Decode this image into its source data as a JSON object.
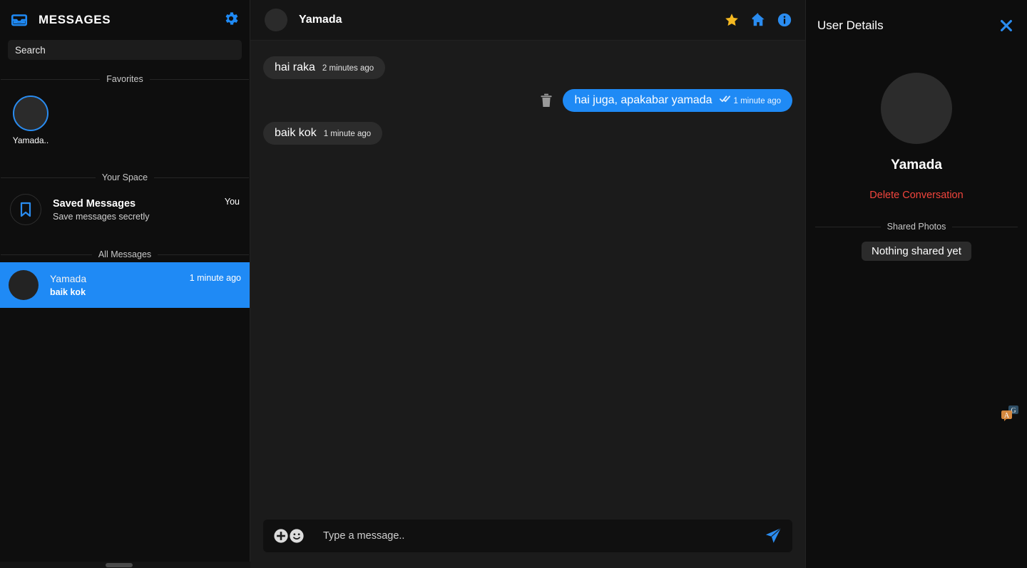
{
  "sidebar": {
    "title": "MESSAGES",
    "inbox_icon": "inbox-icon",
    "settings_icon": "gear-icon",
    "search": {
      "placeholder": "Search",
      "value": ""
    },
    "sections": {
      "favorites_label": "Favorites",
      "your_space_label": "Your Space",
      "all_messages_label": "All Messages"
    },
    "favorites": [
      {
        "name": "Yamada..",
        "avatar_icon": "avatar"
      }
    ],
    "saved_messages": {
      "icon": "bookmark-icon",
      "title": "Saved Messages",
      "subtitle": "Save messages secretly",
      "badge": "You"
    },
    "conversations": [
      {
        "name": "Yamada",
        "preview": "baik kok",
        "time": "1 minute ago",
        "active": true
      }
    ]
  },
  "chat": {
    "contact_name": "Yamada",
    "actions": [
      {
        "name": "favorite-star-icon",
        "color": "#f5b921"
      },
      {
        "name": "home-icon",
        "color": "#2a8cf0"
      },
      {
        "name": "info-icon",
        "color": "#2a8cf0"
      }
    ],
    "messages": [
      {
        "id": "m1",
        "direction": "in",
        "text": "hai raka",
        "time": "2 minutes ago",
        "read_receipt": false,
        "deletable": false
      },
      {
        "id": "m2",
        "direction": "out",
        "text": "hai juga, apakabar yamada",
        "time": "1 minute ago",
        "read_receipt": true,
        "deletable": true,
        "delete_icon": "trash-icon"
      },
      {
        "id": "m3",
        "direction": "in",
        "text": "baik kok",
        "time": "1 minute ago",
        "read_receipt": false,
        "deletable": false
      }
    ],
    "composer": {
      "attach_icon": "plus-circle-icon",
      "emoji_icon": "smiley-icon",
      "placeholder": "Type a message..",
      "value": "",
      "send_icon": "send-icon"
    }
  },
  "details": {
    "title": "User Details",
    "close_icon": "close-icon",
    "user_name": "Yamada",
    "delete_conversation_label": "Delete Conversation",
    "shared_photos_label": "Shared Photos",
    "shared_photos_empty": "Nothing shared yet"
  },
  "overlay": {
    "extension_icon": "translate-extension-icon"
  },
  "colors": {
    "accent_blue": "#1f8af5",
    "icon_blue": "#2a8cf0",
    "star_gold": "#f5b921",
    "danger_red": "#f2453d",
    "bg_sidebar": "#0e0e0e",
    "bg_chat": "#1b1b1b",
    "bubble_in": "#2c2c2c"
  }
}
